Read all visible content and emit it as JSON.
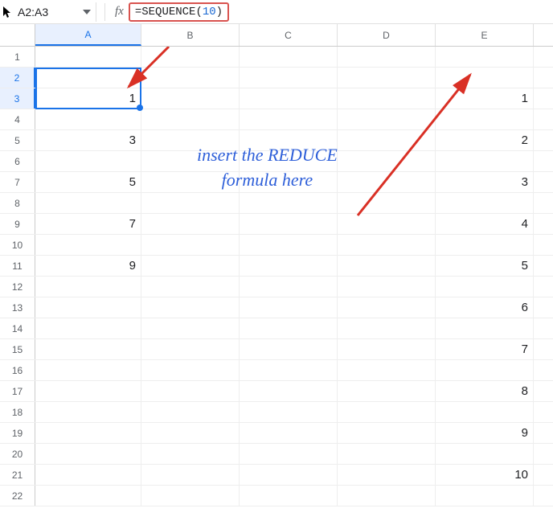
{
  "namebox": {
    "value": "A2:A3"
  },
  "formula_bar": {
    "eq": "=",
    "fn": "SEQUENCE",
    "paren_open": "(",
    "arg": "10",
    "paren_close": ")"
  },
  "columns": [
    "A",
    "B",
    "C",
    "D",
    "E"
  ],
  "rows_count": 22,
  "selected_rows": [
    2,
    3
  ],
  "selected_col": "A",
  "cells_A": {
    "3": "1",
    "5": "3",
    "7": "5",
    "9": "7",
    "11": "9"
  },
  "cells_E": {
    "3": "1",
    "5": "2",
    "7": "3",
    "9": "4",
    "11": "5",
    "13": "6",
    "15": "7",
    "17": "8",
    "19": "9",
    "21": "10"
  },
  "annotation": {
    "line1": "insert the REDUCE",
    "line2": "formula here"
  }
}
